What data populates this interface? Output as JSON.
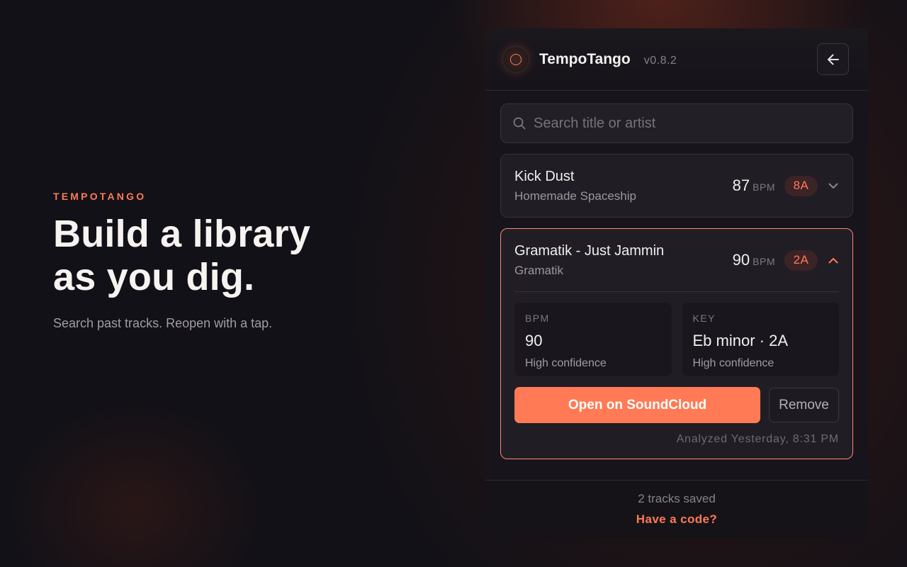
{
  "hero": {
    "eyebrow": "TEMPOTANGO",
    "headline_line1": "Build a library",
    "headline_line2": "as you dig.",
    "subline": "Search past tracks. Reopen with a tap."
  },
  "header": {
    "logo_icon": "circle-logo-icon",
    "app_name": "TempoTango",
    "version": "v0.8.2",
    "back_icon": "arrow-left-icon"
  },
  "search": {
    "icon": "search-icon",
    "placeholder": "Search title or artist",
    "value": ""
  },
  "tracks": [
    {
      "title": "Kick Dust",
      "artist": "Homemade Spaceship",
      "bpm": "87",
      "bpm_unit": "BPM",
      "key": "8A",
      "expanded": false,
      "chevron_icon": "chevron-down-icon"
    },
    {
      "title": "Gramatik - Just Jammin",
      "artist": "Gramatik",
      "bpm": "90",
      "bpm_unit": "BPM",
      "key": "2A",
      "expanded": true,
      "chevron_icon": "chevron-up-icon",
      "details": {
        "bpm_label": "BPM",
        "bpm_value": "90",
        "bpm_confidence": "High confidence",
        "key_label": "KEY",
        "key_value": "Eb minor · 2A",
        "key_confidence": "High confidence",
        "open_label": "Open on SoundCloud",
        "remove_label": "Remove",
        "analyzed": "Analyzed Yesterday, 8:31 PM"
      }
    }
  ],
  "footer": {
    "count": "2 tracks saved",
    "code_link": "Have a code?"
  },
  "colors": {
    "accent": "#ff7a55",
    "background": "#121117",
    "panel": "#17151b",
    "card": "#201d25"
  }
}
